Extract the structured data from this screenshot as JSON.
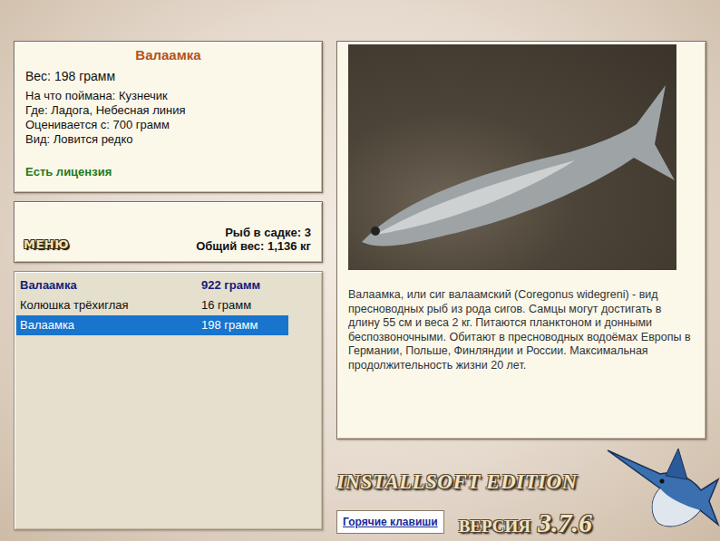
{
  "fish": {
    "name": "Валаамка",
    "weight": "Вес: 198 грамм",
    "details": [
      "На что поймана: Кузнечик",
      "Где: Ладога, Небесная линия",
      "Оценивается с: 700 грамм",
      "Вид: Ловится редко"
    ],
    "license": "Есть лицензия"
  },
  "menu_button": "МЕНЮ",
  "cage": {
    "count": "Рыб в садке: 3",
    "total": "Общий вес: 1,136 кг"
  },
  "catch_list": [
    {
      "name": "Валаамка",
      "weight": "922 грамм",
      "best": true,
      "selected": false
    },
    {
      "name": "Колюшка трёхиглая",
      "weight": "16 грамм",
      "best": false,
      "selected": false
    },
    {
      "name": "Валаамка",
      "weight": "198 грамм",
      "best": false,
      "selected": true
    }
  ],
  "description": "Валаамка, или сиг валаамский (Coregonus widegreni) - вид пресноводных рыб из рода сигов. Самцы могут достигать в длину 55 см и веса 2 кг. Питаются планктоном и донными беспозвоночными. Обитают в пресноводных водоёмах Европы в Германии, Польше, Финляндии и России. Максимальная продолжительность жизни 20 лет.",
  "logo": {
    "brand": "INSTALLSOFT EDITION",
    "version_label": "ВЕРСИЯ",
    "version": "3.7.6"
  },
  "hotkeys_link": "Горячие клавиши"
}
